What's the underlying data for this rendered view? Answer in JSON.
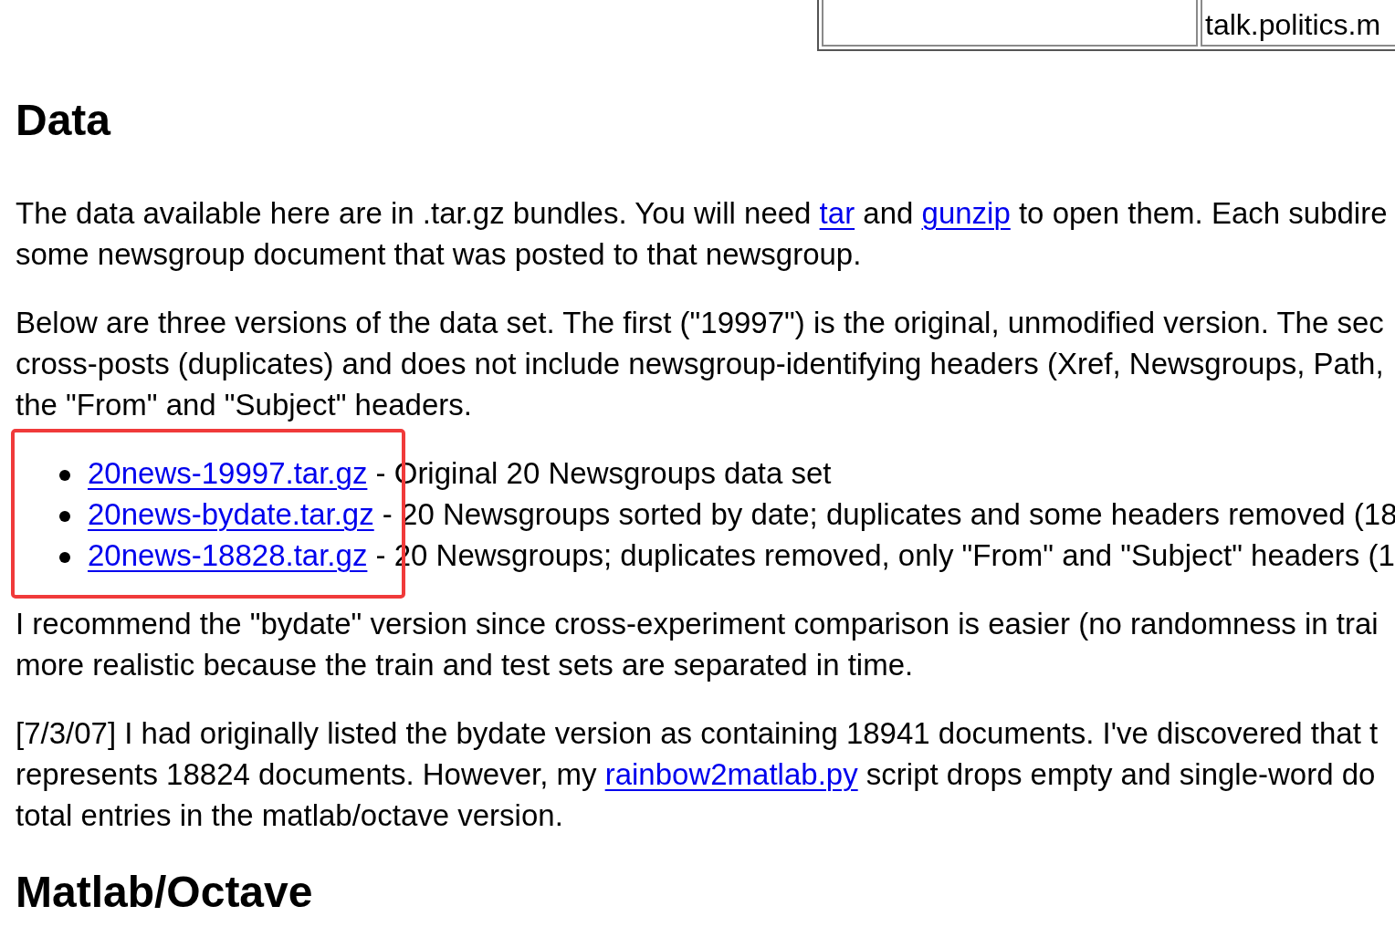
{
  "newsgroup_table": {
    "cells": [
      {
        "kind": "empty"
      },
      {
        "kind": "text",
        "text": "talk.politics.m"
      }
    ]
  },
  "sections": [
    {
      "heading": "Data",
      "blocks": [
        {
          "kind": "paragraph",
          "lines": [
            [
              {
                "kind": "text",
                "text": "The data available here are in .tar.gz bundles. You will need "
              },
              {
                "kind": "link",
                "text": "tar"
              },
              {
                "kind": "text",
                "text": " and "
              },
              {
                "kind": "link",
                "text": "gunzip"
              },
              {
                "kind": "text",
                "text": " to open them. Each subdire"
              }
            ],
            [
              {
                "kind": "text",
                "text": "some newsgroup document that was posted to that newsgroup."
              }
            ]
          ]
        },
        {
          "kind": "paragraph",
          "lines": [
            [
              {
                "kind": "text",
                "text": "Below are three versions of the data set. The first (\"19997\") is the original, unmodified version. The sec"
              }
            ],
            [
              {
                "kind": "text",
                "text": "cross-posts (duplicates) and does not include newsgroup-identifying headers (Xref, Newsgroups, Path,"
              }
            ],
            [
              {
                "kind": "text",
                "text": "the \"From\" and \"Subject\" headers."
              }
            ]
          ]
        },
        {
          "kind": "list",
          "highlighted": true,
          "items": [
            {
              "link": "20news-19997.tar.gz",
              "description": "- Original 20 Newsgroups data set"
            },
            {
              "link": "20news-bydate.tar.gz",
              "description": "- 20 Newsgroups sorted by date; duplicates and some headers removed (18"
            },
            {
              "link": "20news-18828.tar.gz",
              "description": "- 20 Newsgroups; duplicates removed, only \"From\" and \"Subject\" headers (1"
            }
          ]
        },
        {
          "kind": "paragraph",
          "lines": [
            [
              {
                "kind": "text",
                "text": "I recommend the \"bydate\" version since cross-experiment comparison is easier (no randomness in trai"
              }
            ],
            [
              {
                "kind": "text",
                "text": "more realistic because the train and test sets are separated in time."
              }
            ]
          ]
        },
        {
          "kind": "paragraph",
          "lines": [
            [
              {
                "kind": "text",
                "text": "[7/3/07] I had originally listed the bydate version as containing 18941 documents. I've discovered that t"
              }
            ],
            [
              {
                "kind": "text",
                "text": "represents 18824 documents. However, my "
              },
              {
                "kind": "link",
                "text": "rainbow2matlab.py"
              },
              {
                "kind": "text",
                "text": " script drops empty and single-word do"
              }
            ],
            [
              {
                "kind": "text",
                "text": "total entries in the matlab/octave version."
              }
            ]
          ]
        }
      ]
    },
    {
      "heading": "Matlab/Octave"
    }
  ]
}
